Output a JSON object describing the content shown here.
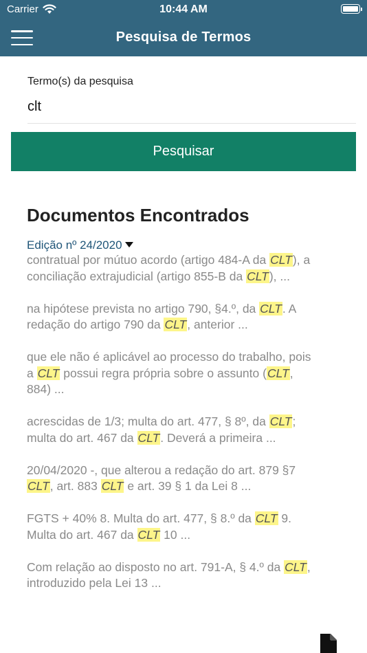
{
  "status_bar": {
    "carrier": "Carrier",
    "time": "10:44 AM"
  },
  "nav": {
    "title": "Pesquisa de Termos"
  },
  "search": {
    "label": "Termo(s) da pesquisa",
    "value": "clt",
    "button_label": "Pesquisar"
  },
  "results": {
    "title": "Documentos Encontrados",
    "edition_label": "Edição nº 24/2020",
    "snippets": [
      [
        "contratual por mútuo acordo (artigo 484-A da ",
        {
          "hl": "CLT"
        },
        "), a conciliação extrajudicial (artigo 855-B da ",
        {
          "hl": "CLT"
        },
        "), ..."
      ],
      [
        "na hipótese prevista no artigo 790, §4.º, da ",
        {
          "hl": "CLT"
        },
        ". A redação do artigo 790 da ",
        {
          "hl": "CLT"
        },
        ", anterior ..."
      ],
      [
        "que ele não é aplicável ao processo do trabalho, pois a ",
        {
          "hl": "CLT"
        },
        " possui regra própria sobre o assunto (",
        {
          "hl": "CLT"
        },
        ", 884) ..."
      ],
      [
        "acrescidas de 1/3; multa do art. 477, § 8º, da ",
        {
          "hl": "CLT"
        },
        "; multa do art. 467 da ",
        {
          "hl": "CLT"
        },
        ". Deverá a primeira ..."
      ],
      [
        "20/04/2020 -, que alterou a redação do art. 879 §7 ",
        {
          "hl": "CLT"
        },
        ", art. 883 ",
        {
          "hl": "CLT"
        },
        " e art. 39 § 1 da Lei 8 ..."
      ],
      [
        "FGTS + 40% 8. Multa do art. 477, § 8.º da ",
        {
          "hl": "CLT"
        },
        " 9. Multa do art. 467 da ",
        {
          "hl": "CLT"
        },
        " 10 ..."
      ],
      [
        "Com relação ao disposto no art. 791-A, § 4.º da ",
        {
          "hl": "CLT"
        },
        ", introduzido pela Lei 13 ..."
      ]
    ]
  },
  "icons": {
    "menu": "hamburger-menu-icon",
    "wifi": "wifi-icon",
    "battery": "battery-icon",
    "document": "document-icon",
    "caret": "caret-down-icon"
  },
  "colors": {
    "nav_bar": "#336680",
    "search_button": "#128066",
    "edition_link": "#1f5578",
    "highlight": "#fdf58a",
    "snippet_text": "#8a8a8a"
  }
}
